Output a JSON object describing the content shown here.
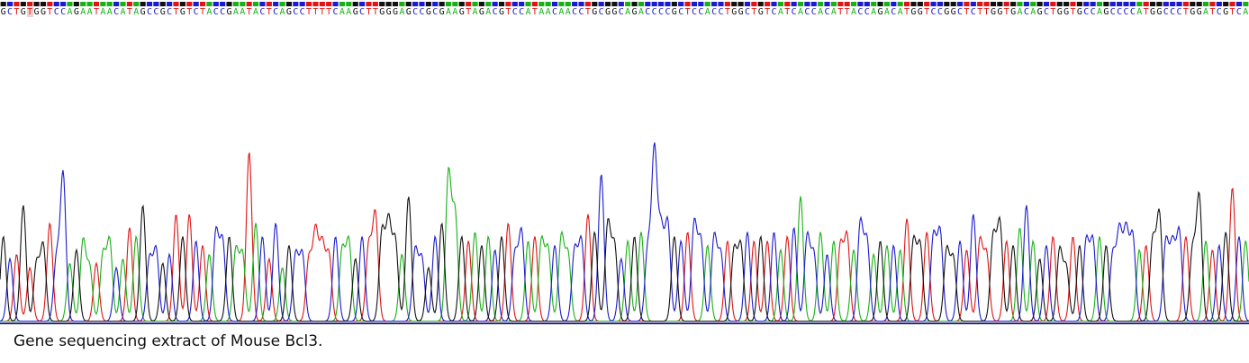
{
  "caption": "Gene sequencing extract of Mouse Bcl3.",
  "colors": {
    "A": "#17b117",
    "C": "#1a1acf",
    "G": "#111111",
    "T": "#e01414",
    "baseline": "#2a2a7a",
    "highlight": "#f3d0d0"
  },
  "chart_data": {
    "type": "line",
    "title": "",
    "xlabel": "",
    "ylabel": "",
    "grid": false,
    "legend": "none",
    "sequence": "GCTGTGGTCCAGAATAACATAGCCGCTGTCTACCGAATACTCAGCCTTTTCAAGCTTGGGAGCCGCGAAGTAGACGTCCATAACAACCTGCGGCAGACCCCGCTCCACCTGGCTGTCATCACCACATTACCAGACATGGTCCGGCTCTTGGTGACAGCTGGTGCCAGCCCCATGGCCCTGGATCGTCA",
    "highlighted_base_index": 4,
    "ylim": [
      0,
      200
    ],
    "peak_heights": [
      95,
      70,
      75,
      130,
      60,
      65,
      85,
      110,
      70,
      165,
      65,
      80,
      90,
      60,
      65,
      75,
      90,
      60,
      70,
      105,
      95,
      130,
      70,
      80,
      65,
      75,
      120,
      95,
      120,
      90,
      85,
      75,
      100,
      90,
      95,
      80,
      75,
      190,
      110,
      95,
      70,
      110,
      60,
      85,
      75,
      75,
      70,
      100,
      85,
      75,
      95,
      80,
      90,
      70,
      95,
      85,
      120,
      100,
      110,
      90,
      75,
      140,
      80,
      70,
      60,
      95,
      110,
      165,
      120,
      95,
      90,
      100,
      85,
      95,
      80,
      95,
      110,
      75,
      100,
      90,
      95,
      90,
      80,
      85,
      95,
      75,
      80,
      90,
      120,
      100,
      165,
      110,
      85,
      70,
      90,
      95,
      100,
      80,
      190,
      100,
      110,
      95,
      90,
      100,
      110,
      90,
      85,
      95,
      75,
      90,
      80,
      85,
      100,
      90,
      95,
      90,
      100,
      80,
      95,
      105,
      140,
      95,
      75,
      100,
      75,
      90,
      85,
      95,
      80,
      110,
      90,
      75,
      90,
      85,
      85,
      80,
      115,
      90,
      85,
      100,
      95,
      100,
      80,
      70,
      90,
      80,
      120,
      90,
      75,
      95,
      110,
      90,
      85,
      105,
      130,
      90,
      70,
      85,
      95,
      80,
      60,
      95,
      85,
      90,
      90,
      95,
      85,
      75,
      100,
      100,
      95,
      80,
      85,
      90,
      120,
      90,
      85,
      100,
      95,
      80,
      140,
      90,
      80,
      85,
      100,
      150,
      95,
      90,
      70,
      95,
      80,
      80,
      110,
      90,
      70,
      85,
      80,
      70,
      60,
      85
    ]
  }
}
